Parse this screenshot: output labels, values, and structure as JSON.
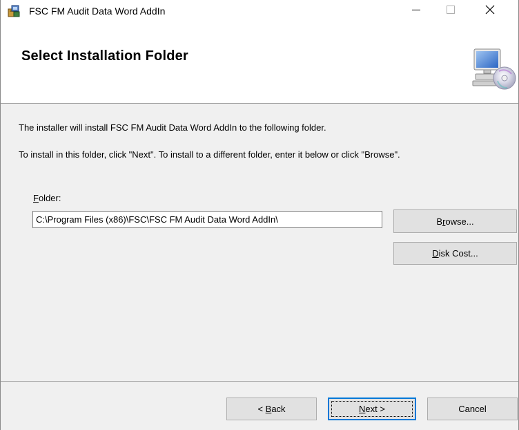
{
  "window": {
    "title": "FSC FM Audit Data Word AddIn",
    "icons": {
      "app": "installer-icon",
      "minimize": "minimize-icon",
      "maximize": "maximize-icon",
      "close": "close-icon"
    }
  },
  "header": {
    "title": "Select Installation Folder",
    "icon": "computer-cd-icon"
  },
  "body": {
    "line1": "The installer will install FSC FM Audit Data Word AddIn to the following folder.",
    "line2": "To install in this folder, click \"Next\". To install to a different folder, enter it below or click \"Browse\".",
    "folder_label_mnemonic": "F",
    "folder_label_rest": "older:",
    "folder_value": "C:\\Program Files (x86)\\FSC\\FSC FM Audit Data Word AddIn\\",
    "browse_pre": "B",
    "browse_mnemonic": "r",
    "browse_post": "owse...",
    "diskcost_mnemonic": "D",
    "diskcost_post": "isk Cost..."
  },
  "footer": {
    "back_pre": "< ",
    "back_mnemonic": "B",
    "back_post": "ack",
    "next_mnemonic": "N",
    "next_post": "ext >",
    "cancel_label": "Cancel"
  },
  "colors": {
    "window_bg": "#f0f0f0",
    "focus_border": "#0078d7",
    "button_bg": "#e1e1e1"
  }
}
